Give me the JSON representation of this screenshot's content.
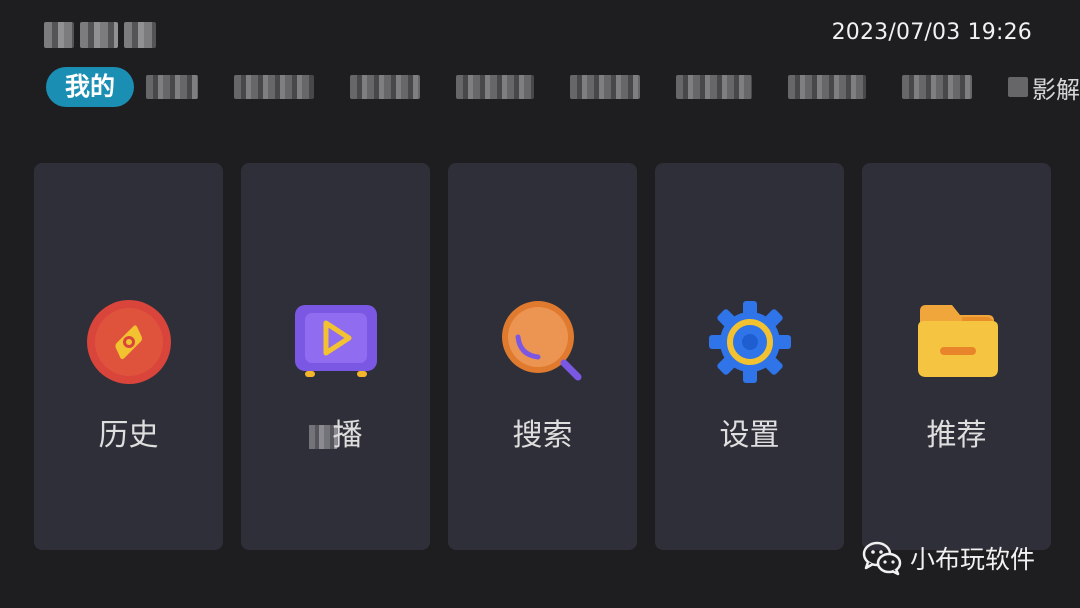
{
  "header": {
    "clock": "2023/07/03 19:26"
  },
  "tabs": {
    "active_label": "我的",
    "last_partial_label": "影解"
  },
  "cards": [
    {
      "label": "历史",
      "icon": "compass-icon"
    },
    {
      "label": "播",
      "icon": "tv-play-icon"
    },
    {
      "label": "搜索",
      "icon": "search-icon"
    },
    {
      "label": "设置",
      "icon": "gear-icon"
    },
    {
      "label": "推荐",
      "icon": "folder-icon"
    }
  ],
  "watermark": {
    "text": "小布玩软件",
    "icon": "wechat-icon"
  },
  "colors": {
    "background": "#1e1e20",
    "card": "#2e2f38",
    "active_tab": "#1b8fb3"
  }
}
